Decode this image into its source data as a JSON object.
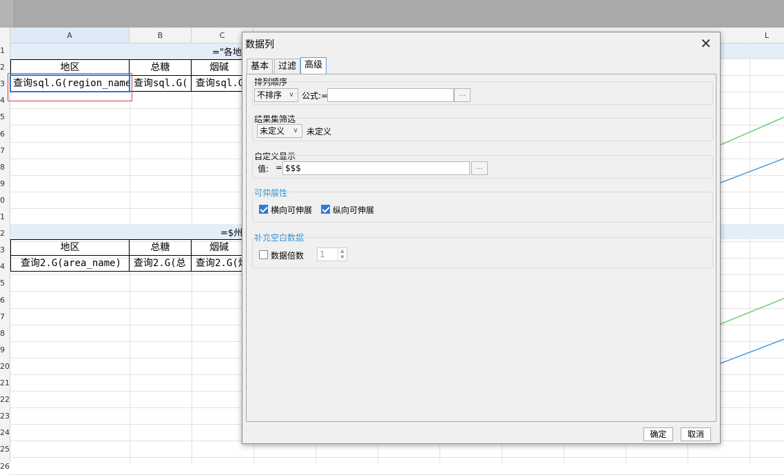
{
  "sheet": {
    "columns": [
      "A",
      "B",
      "C",
      "L"
    ],
    "rows": [
      "1",
      "2",
      "3",
      "4",
      "5",
      "6",
      "7",
      "8",
      "9",
      "0",
      "1",
      "2",
      "3",
      "4",
      "5",
      "6",
      "7",
      "8",
      "9",
      "20",
      "21",
      "22",
      "23",
      "24",
      "25",
      "26"
    ],
    "r1_title": "=\"各地",
    "r12_title": "=$州",
    "table1": {
      "area": "地区",
      "sugar": "总糖",
      "nicotine": "烟碱",
      "a3": "查询sql.G(region_name",
      "b3": "查询sql.G(",
      "c3": "查询sql.G"
    },
    "table2": {
      "area": "地区",
      "sugar": "总糖",
      "nicotine": "烟碱",
      "a14": "查询2.G(area_name)",
      "b14": "查询2.G(总",
      "c14": "查询2.G(烟"
    }
  },
  "dialog": {
    "title": "数据列",
    "tabs": [
      "基本",
      "过滤",
      "高级"
    ],
    "active_tab": "高级",
    "sort": {
      "label": "排列顺序",
      "value": "不排序",
      "formula_label": "公式:=",
      "formula_value": ""
    },
    "filter": {
      "label": "结果集筛选",
      "value": "未定义",
      "text": "未定义"
    },
    "custom": {
      "label": "自定义显示",
      "value_label": "值:",
      "eq": "=",
      "value": "$$$"
    },
    "expand": {
      "label": "可伸展性",
      "horizontal": "横向可伸展",
      "vertical": "纵向可伸展",
      "horizontal_checked": true,
      "vertical_checked": true
    },
    "fill": {
      "label": "补充空白数据",
      "multiple_label": "数据倍数",
      "multiple_value": "1",
      "checked": false
    },
    "ok": "确定",
    "cancel": "取消",
    "dots": "..."
  },
  "colors": {
    "accent": "#2e8fd4",
    "selection": "#2b77d6",
    "green_line": "#6fd07a",
    "blue_line": "#4a9be0"
  }
}
